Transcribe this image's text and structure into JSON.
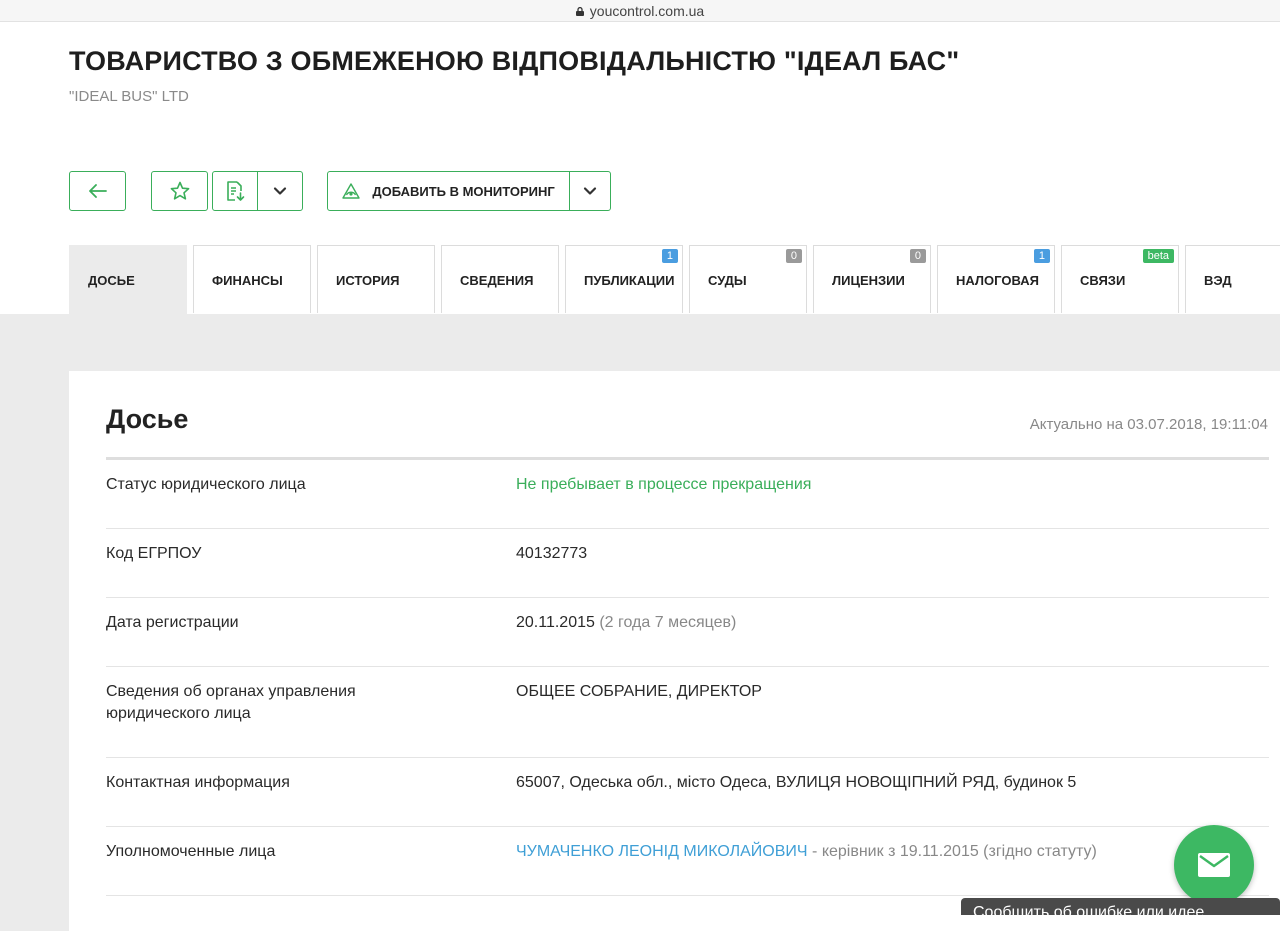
{
  "browser": {
    "url": "youcontrol.com.ua"
  },
  "company": {
    "title": "ТОВАРИСТВО З ОБМЕЖЕНОЮ ВІДПОВІДАЛЬНІСТЮ \"ІДЕАЛ БАС\"",
    "subtitle": "\"IDEAL BUS\" LTD"
  },
  "toolbar": {
    "monitor_label": "ДОБАВИТЬ В МОНИТОРИНГ"
  },
  "tabs": [
    {
      "label": "ДОСЬЕ",
      "badge": null,
      "active": true
    },
    {
      "label": "ФИНАНСЫ",
      "badge": null
    },
    {
      "label": "ИСТОРИЯ",
      "badge": null
    },
    {
      "label": "СВЕДЕНИЯ",
      "badge": null
    },
    {
      "label": "ПУБЛИКАЦИИ",
      "badge": "1",
      "badge_color": "#4a9de0"
    },
    {
      "label": "СУДЫ",
      "badge": "0",
      "badge_color": "#9a9a9a"
    },
    {
      "label": "ЛИЦЕНЗИИ",
      "badge": "0",
      "badge_color": "#9a9a9a"
    },
    {
      "label": "НАЛОГОВАЯ",
      "badge": "1",
      "badge_color": "#4a9de0"
    },
    {
      "label": "СВЯЗИ",
      "badge": "beta",
      "badge_color": "#3db863"
    },
    {
      "label": "ВЭД",
      "badge": null
    }
  ],
  "dossier": {
    "title": "Досье",
    "updated": "Актуально на 03.07.2018, 19:11:04",
    "rows": {
      "status": {
        "label": "Статус юридического лица",
        "value": "Не пребывает в процессе прекращения"
      },
      "code": {
        "label": "Код ЕГРПОУ",
        "value": "40132773"
      },
      "reg_date": {
        "label": "Дата регистрации",
        "value": "20.11.2015",
        "extra": " (2 года 7 месяцев)"
      },
      "management": {
        "label": "Сведения об органах управления юридического лица",
        "value": "ОБЩЕЕ СОБРАНИЕ, ДИРЕКТОР"
      },
      "contact": {
        "label": "Контактная информация",
        "value": "65007, Одеська обл., місто Одеса, ВУЛИЦЯ НОВОЩІПНИЙ РЯД, будинок 5"
      },
      "authorized": {
        "label": "Уполномоченные лица",
        "person": "ЧУМАЧЕНКО ЛЕОНІД МИКОЛАЙОВИЧ",
        "role": " - керівник з 19.11.2015 (згідно статуту)"
      }
    }
  },
  "feedback": {
    "label": "Сообщить об ошибке или идее"
  },
  "colors": {
    "accent": "#3aae5a",
    "link": "#3f9fd6"
  }
}
